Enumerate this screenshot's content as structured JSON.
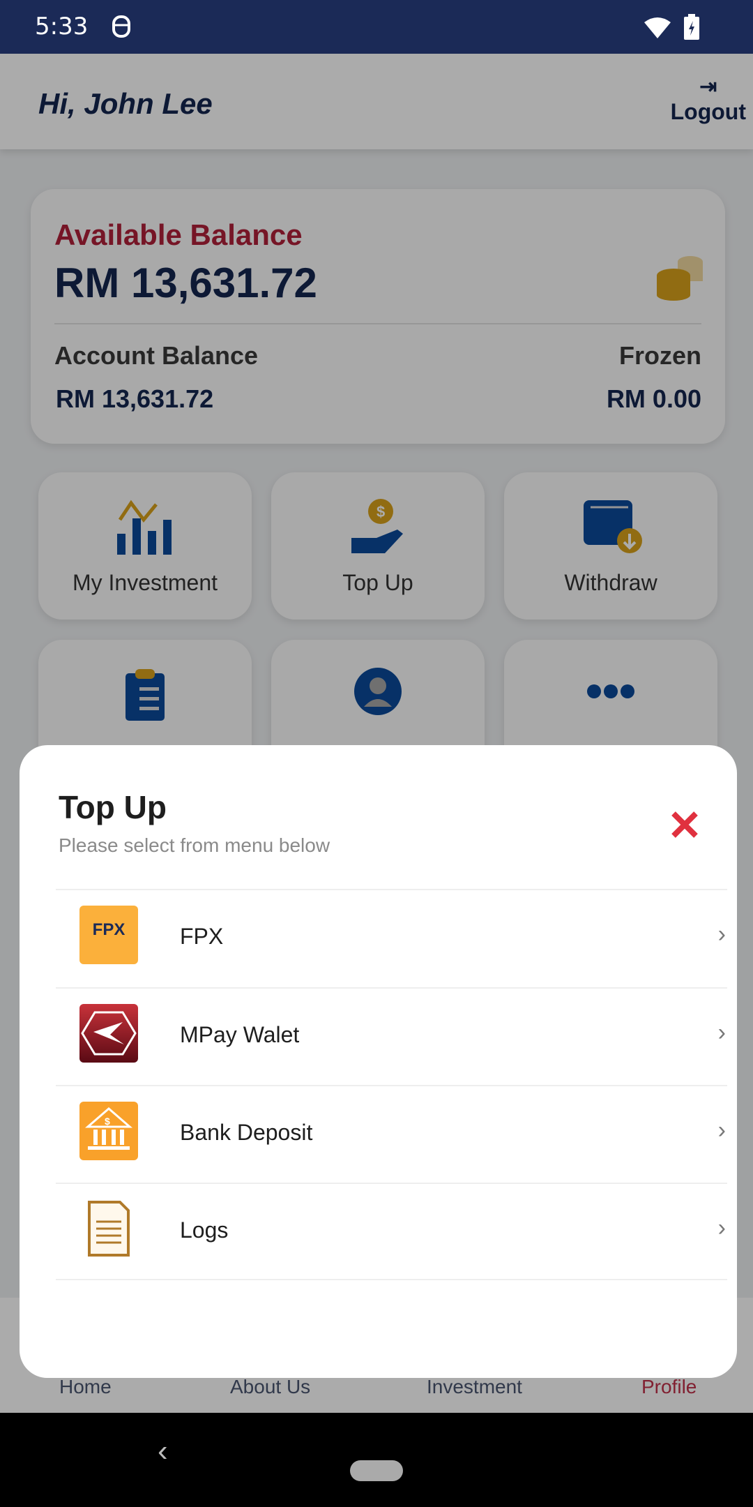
{
  "status_bar": {
    "time": "5:33"
  },
  "header": {
    "greeting": "Hi, John Lee",
    "logout_label": "Logout"
  },
  "balance": {
    "available_label": "Available Balance",
    "available_value": "RM 13,631.72",
    "account_label": "Account Balance",
    "account_value": "RM 13,631.72",
    "frozen_label": "Frozen",
    "frozen_value": "RM 0.00"
  },
  "tiles": [
    {
      "label": "My Investment",
      "icon": "chart-icon"
    },
    {
      "label": "Top Up",
      "icon": "hand-coin-icon"
    },
    {
      "label": "Withdraw",
      "icon": "wallet-icon"
    },
    {
      "label": "",
      "icon": "clipboard-icon"
    },
    {
      "label": "",
      "icon": "user-icon"
    },
    {
      "label": "",
      "icon": "more-icon"
    }
  ],
  "bottom_nav": {
    "items": [
      {
        "label": "Home"
      },
      {
        "label": "About Us"
      },
      {
        "label": "Investment"
      },
      {
        "label": "Profile",
        "active": true
      }
    ]
  },
  "sheet": {
    "title": "Top Up",
    "subtitle": "Please select from menu below",
    "items": [
      {
        "label": "FPX",
        "icon": "fpx-logo",
        "logo_text": "FPX"
      },
      {
        "label": "MPay Walet",
        "icon": "mpay-logo"
      },
      {
        "label": "Bank Deposit",
        "icon": "bank-icon"
      },
      {
        "label": "Logs",
        "icon": "logs-icon"
      }
    ]
  },
  "colors": {
    "navy": "#142650",
    "red": "#b0203a",
    "gold": "#d9a21b",
    "blue": "#0b4a9a",
    "close": "#e0313f"
  }
}
